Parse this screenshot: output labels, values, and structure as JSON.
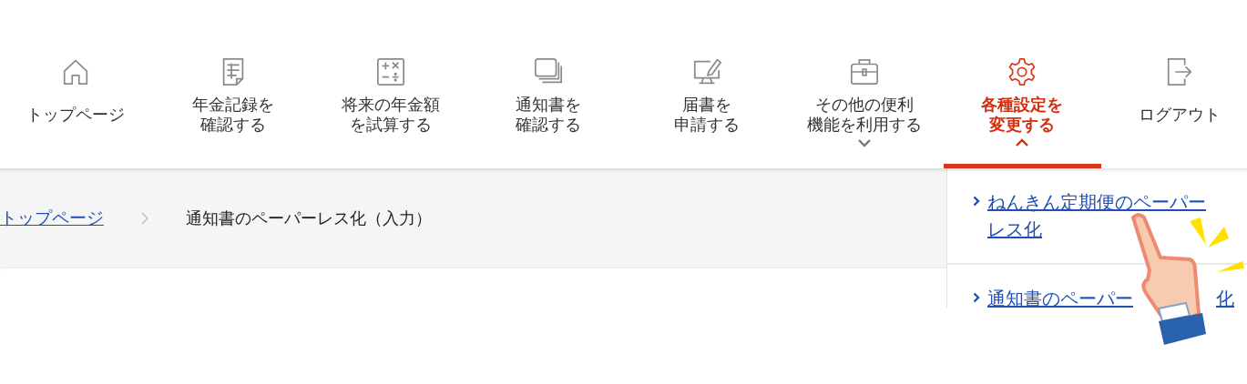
{
  "nav": [
    {
      "lines": [
        "トップページ"
      ],
      "selected": false
    },
    {
      "lines": [
        "年金記録を",
        "確認する"
      ],
      "selected": false
    },
    {
      "lines": [
        "将来の年金額",
        "を試算する"
      ],
      "selected": false
    },
    {
      "lines": [
        "通知書を",
        "確認する"
      ],
      "selected": false
    },
    {
      "lines": [
        "届書を",
        "申請する"
      ],
      "selected": false
    },
    {
      "lines": [
        "その他の便利",
        "機能を利用する"
      ],
      "selected": false,
      "expanded": false
    },
    {
      "lines": [
        "各種設定を",
        "変更する"
      ],
      "selected": true,
      "expanded": true
    },
    {
      "lines": [
        "ログアウト"
      ],
      "selected": false
    }
  ],
  "breadcrumb": {
    "link": "トップページ",
    "current": "通知書のペーパーレス化（入力）"
  },
  "dropdown": {
    "items": [
      {
        "lines": [
          "ねんきん定期便のペーパー",
          "レス化"
        ]
      },
      {
        "visible_start": "通知書のペーパー",
        "visible_end": "化"
      }
    ]
  }
}
